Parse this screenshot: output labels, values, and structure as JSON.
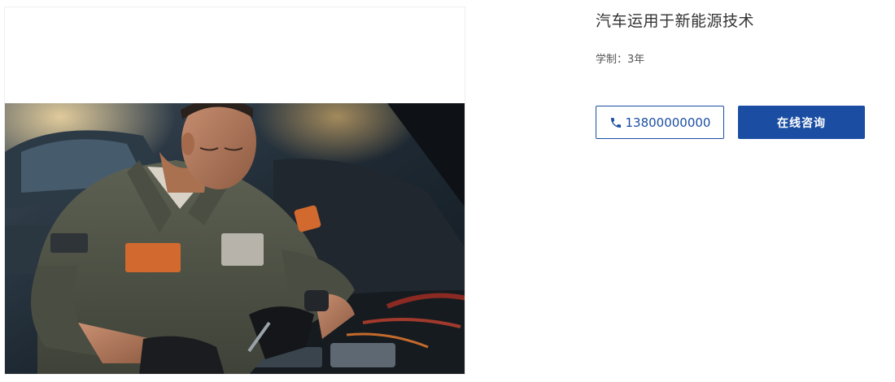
{
  "course": {
    "title": "汽车运用于新能源技术",
    "duration_label": "学制：",
    "duration_value": "3年"
  },
  "actions": {
    "phone_number": "13800000000",
    "consult_label": "在线咨询"
  },
  "colors": {
    "accent": "#1b4ea3",
    "title_text": "#333333",
    "meta_text": "#555555"
  },
  "icons": {
    "phone": "phone-icon"
  },
  "image": {
    "subject": "mechanic-working-on-engine-photo"
  }
}
